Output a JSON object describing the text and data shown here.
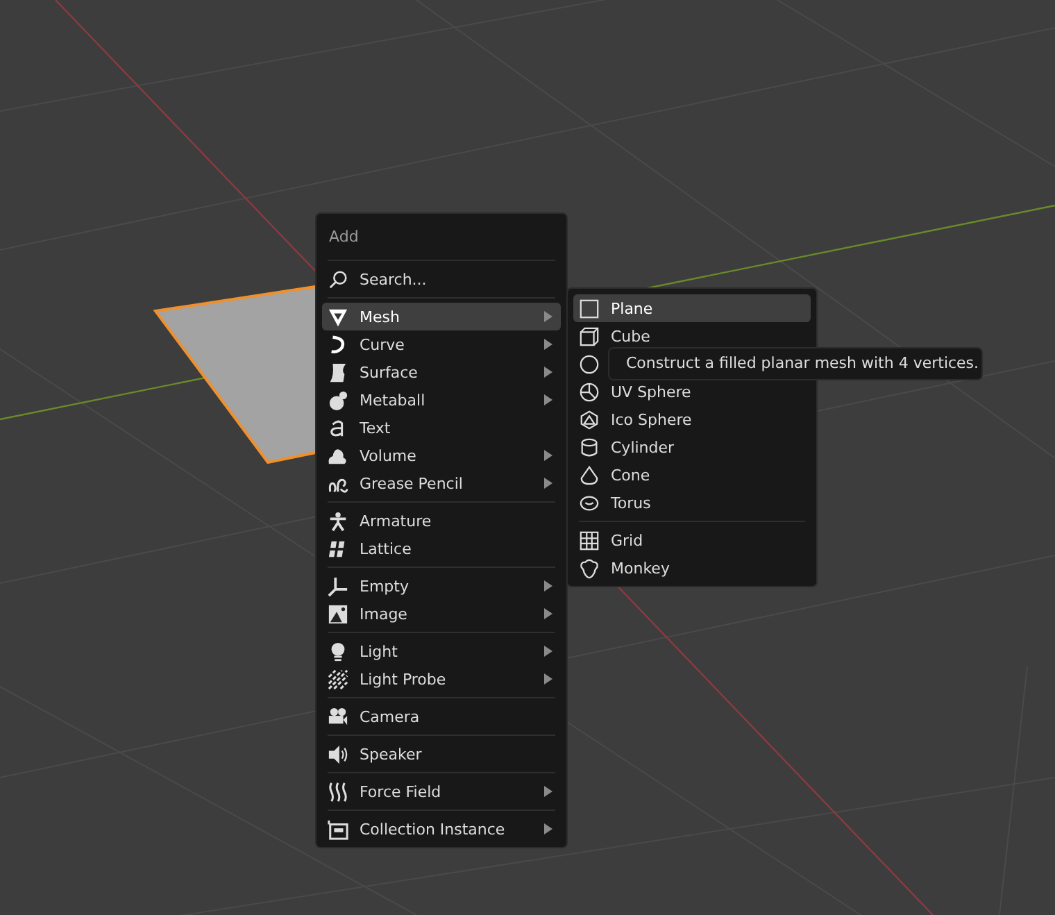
{
  "add_menu": {
    "title": "Add",
    "search": {
      "label": "Search..."
    },
    "groups": [
      [
        {
          "label": "Mesh",
          "has_submenu": true,
          "selected": true
        },
        {
          "label": "Curve",
          "has_submenu": true,
          "selected": false
        },
        {
          "label": "Surface",
          "has_submenu": true,
          "selected": false
        },
        {
          "label": "Metaball",
          "has_submenu": true,
          "selected": false
        },
        {
          "label": "Text",
          "has_submenu": false,
          "selected": false
        },
        {
          "label": "Volume",
          "has_submenu": true,
          "selected": false
        },
        {
          "label": "Grease Pencil",
          "has_submenu": true,
          "selected": false
        }
      ],
      [
        {
          "label": "Armature",
          "has_submenu": false,
          "selected": false
        },
        {
          "label": "Lattice",
          "has_submenu": false,
          "selected": false
        }
      ],
      [
        {
          "label": "Empty",
          "has_submenu": true,
          "selected": false
        },
        {
          "label": "Image",
          "has_submenu": true,
          "selected": false
        }
      ],
      [
        {
          "label": "Light",
          "has_submenu": true,
          "selected": false
        },
        {
          "label": "Light Probe",
          "has_submenu": true,
          "selected": false
        }
      ],
      [
        {
          "label": "Camera",
          "has_submenu": false,
          "selected": false
        }
      ],
      [
        {
          "label": "Speaker",
          "has_submenu": false,
          "selected": false
        }
      ],
      [
        {
          "label": "Force Field",
          "has_submenu": true,
          "selected": false
        }
      ],
      [
        {
          "label": "Collection Instance",
          "has_submenu": true,
          "selected": false
        }
      ]
    ]
  },
  "mesh_menu": {
    "groups": [
      [
        {
          "label": "Plane",
          "selected": true
        },
        {
          "label": "Cube",
          "selected": false
        },
        {
          "selected": false
        },
        {
          "label": "UV Sphere",
          "selected": false
        },
        {
          "label": "Ico Sphere",
          "selected": false
        },
        {
          "label": "Cylinder",
          "selected": false
        },
        {
          "label": "Cone",
          "selected": false
        },
        {
          "label": "Torus",
          "selected": false
        }
      ],
      [
        {
          "label": "Grid",
          "selected": false
        },
        {
          "label": "Monkey",
          "selected": false
        }
      ]
    ]
  },
  "tooltip": {
    "text": "Construct a filled planar mesh with 4 vertices."
  }
}
